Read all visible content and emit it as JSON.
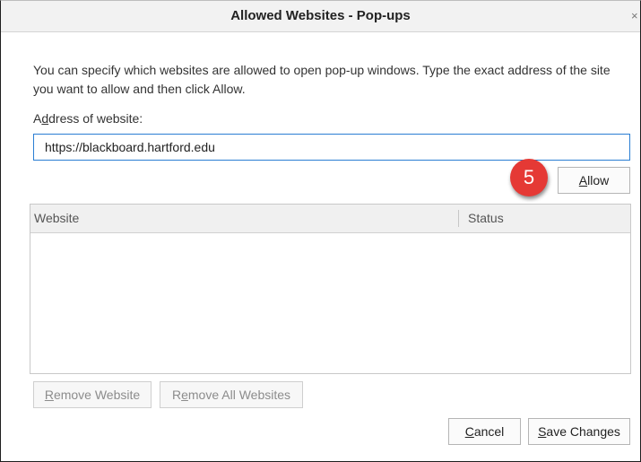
{
  "window": {
    "title": "Allowed Websites - Pop-ups",
    "close_glyph": "×"
  },
  "description": "You can specify which websites are allowed to open pop-up windows. Type the exact address of the site you want to allow and then click Allow.",
  "address": {
    "label_prefix": "A",
    "label_access_key": "d",
    "label_rest": "dress of website:",
    "value": "https://blackboard.hartford.edu"
  },
  "step_badge": "5",
  "allow_button": {
    "access_key": "A",
    "rest": "llow"
  },
  "table": {
    "columns": [
      "Website",
      "Status"
    ],
    "rows": []
  },
  "remove_button": {
    "access_key": "R",
    "rest": "emove Website"
  },
  "remove_all_button": {
    "prefix": "R",
    "access_key": "e",
    "rest": "move All Websites"
  },
  "cancel_button": {
    "access_key": "C",
    "rest": "ancel"
  },
  "save_button": {
    "access_key": "S",
    "rest": "ave Changes"
  },
  "colors": {
    "badge": "#e53935",
    "input_focus_border": "#2a7ed3"
  }
}
